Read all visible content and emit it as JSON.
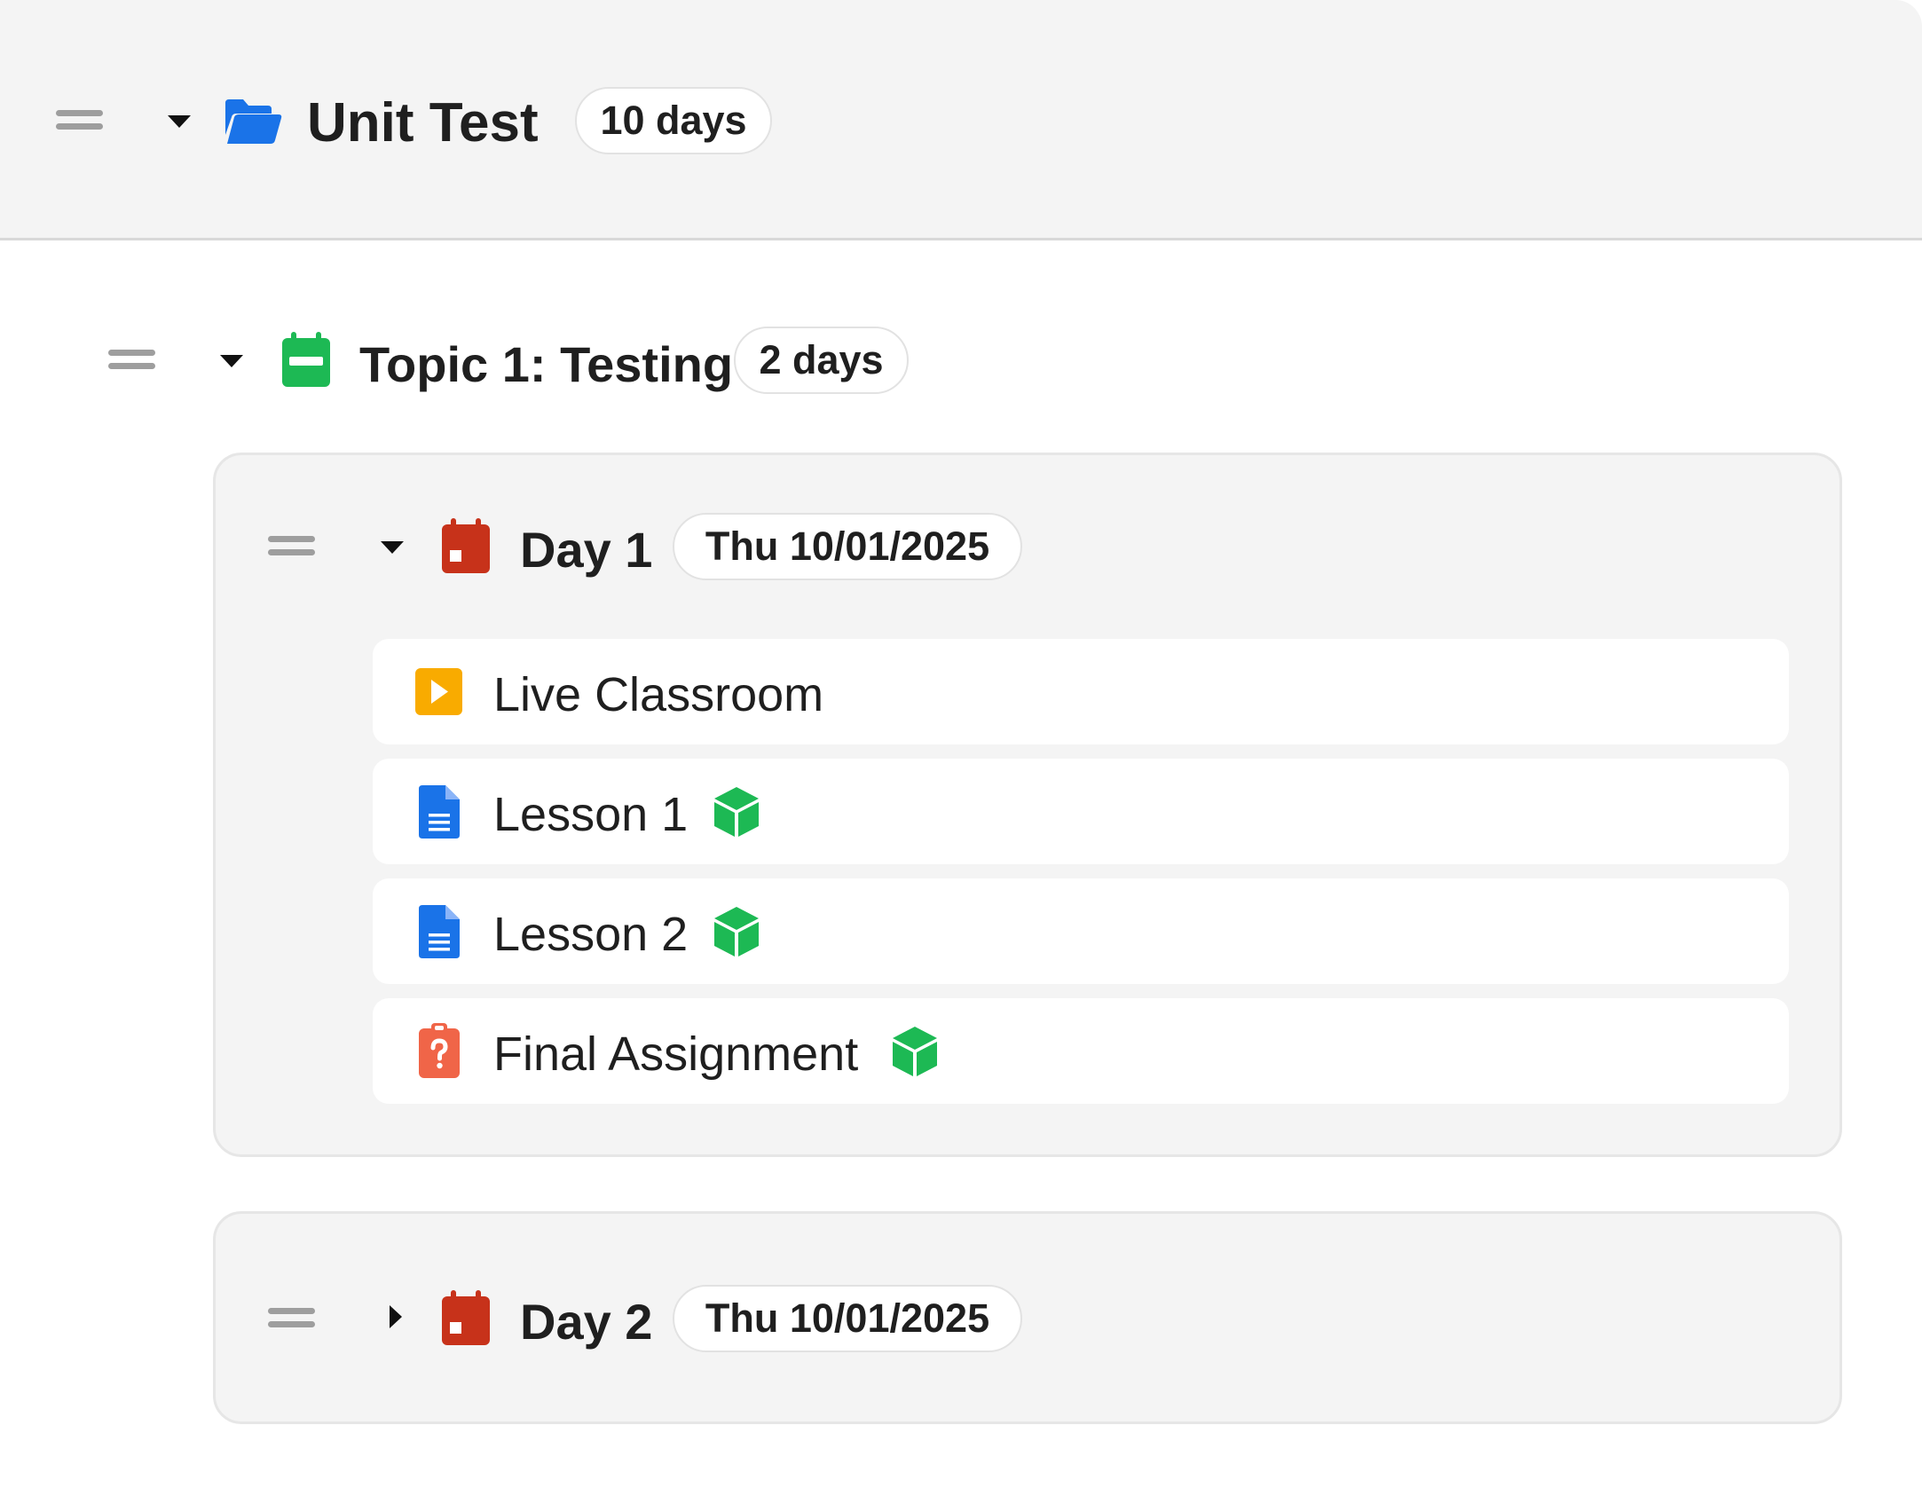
{
  "unit": {
    "title": "Unit Test",
    "duration": "10 days",
    "icon": "folder-open-icon",
    "accent": "#1a73e8"
  },
  "topic": {
    "title": "Topic 1: Testing",
    "duration": "2 days",
    "icon": "calendar-icon",
    "accent": "#1db954"
  },
  "days": [
    {
      "title": "Day 1",
      "date": "Thu 10/01/2025",
      "expanded": true,
      "icon": "calendar-day-icon",
      "accent": "#c7321a",
      "items": [
        {
          "label": "Live Classroom",
          "icon": "play-icon",
          "color": "#f9ab00",
          "badge": false
        },
        {
          "label": "Lesson 1",
          "icon": "document-icon",
          "color": "#1a73e8",
          "badge": true
        },
        {
          "label": "Lesson 2",
          "icon": "document-icon",
          "color": "#1a73e8",
          "badge": true
        },
        {
          "label": "Final Assignment",
          "icon": "assignment-icon",
          "color": "#f06548",
          "badge": true
        }
      ]
    },
    {
      "title": "Day 2",
      "date": "Thu 10/01/2025",
      "expanded": false,
      "icon": "calendar-day-icon",
      "accent": "#c7321a",
      "items": []
    }
  ],
  "badge": {
    "icon": "cube-icon",
    "color": "#1db954"
  }
}
